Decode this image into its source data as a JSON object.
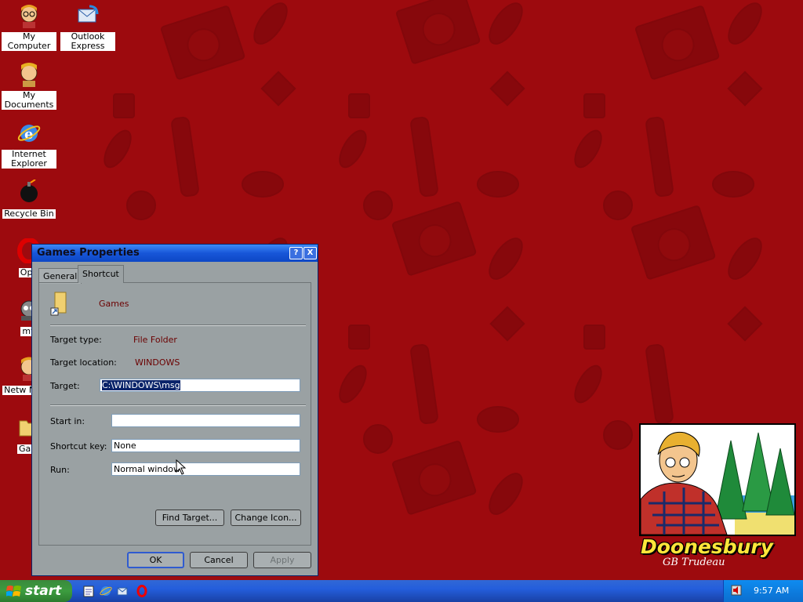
{
  "desktop": {
    "icons": [
      {
        "label": "My Computer",
        "icon": "my-computer-icon"
      },
      {
        "label": "Outlook Express",
        "icon": "outlook-express-icon"
      },
      {
        "label": "My Documents",
        "icon": "my-documents-icon"
      },
      {
        "label": "Internet Explorer",
        "icon": "internet-explorer-icon"
      },
      {
        "label": "Recycle Bin",
        "icon": "recycle-bin-icon"
      },
      {
        "label": "Ope",
        "icon": "opera-icon"
      },
      {
        "label": "my",
        "icon": "my-network-icon"
      },
      {
        "label": "Netw Neigh",
        "icon": "network-neighborhood-icon"
      },
      {
        "label": "Gam",
        "icon": "games-folder-icon"
      }
    ],
    "wallpaper_brand": "Doonesbury",
    "wallpaper_signature": "GB Trudeau",
    "colors": {
      "wallpaper": "#9d0a0e",
      "brand_text": "#ffe63a"
    }
  },
  "dialog": {
    "title": "Games Properties",
    "tabs": [
      "General",
      "Shortcut"
    ],
    "active_tab": "Shortcut",
    "name": "Games",
    "target_type_label": "Target type:",
    "target_type_value": "File Folder",
    "target_location_label": "Target location:",
    "target_location_value": "WINDOWS",
    "target_label": "Target:",
    "target_value": "C:\\WINDOWS\\msg",
    "start_in_label": "Start in:",
    "start_in_value": "",
    "shortcut_key_label": "Shortcut key:",
    "shortcut_key_value": "None",
    "run_label": "Run:",
    "run_value": "Normal window",
    "find_target_button": "Find Target...",
    "change_icon_button": "Change Icon...",
    "ok_button": "OK",
    "cancel_button": "Cancel",
    "apply_button": "Apply",
    "help_glyph": "?",
    "close_glyph": "X"
  },
  "taskbar": {
    "start_label": "start",
    "quick_launch": [
      "notepad-icon",
      "internet-explorer-icon",
      "outlook-express-icon",
      "opera-icon"
    ],
    "clock": "9:57 AM",
    "tray_icon": "volume-icon"
  }
}
